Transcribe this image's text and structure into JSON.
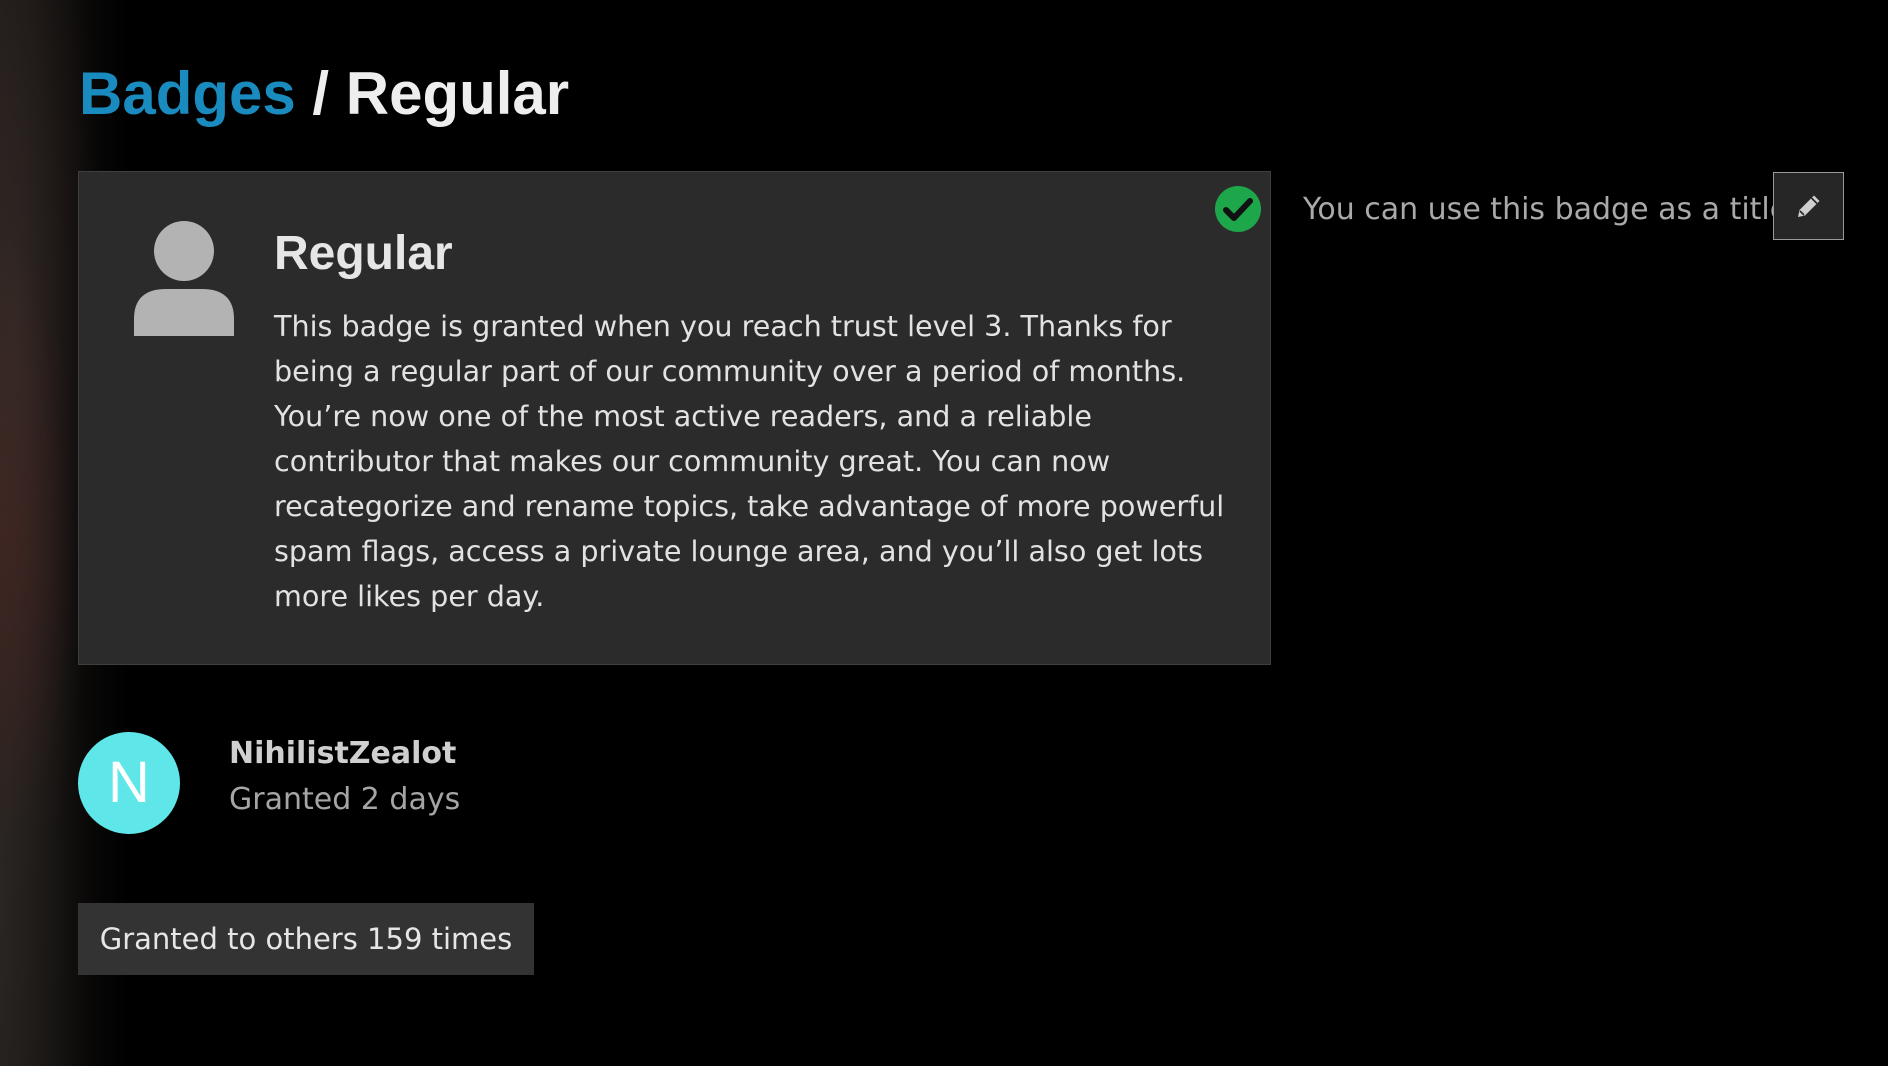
{
  "breadcrumb": {
    "parent_label": "Badges",
    "separator": " / ",
    "current_label": "Regular"
  },
  "badge": {
    "title": "Regular",
    "description": "This badge is granted when you reach trust level 3. Thanks for being a regular part of our community over a period of months. You’re now one of the most active readers, and a reliable contributor that makes our community great. You can now recategorize and rename topics, take advantage of more powerful spam flags, access a private lounge area, and you’ll also get lots more likes per day.",
    "icon": "user-icon",
    "granted_status_icon": "check-circle-icon"
  },
  "title_option": {
    "hint": "You can use this badge as a title",
    "edit_icon": "pencil-icon"
  },
  "grant": {
    "avatar_letter": "N",
    "username": "NihilistZealot",
    "granted_text": "Granted 2 days"
  },
  "others": {
    "button_label": "Granted to others 159 times"
  },
  "colors": {
    "link": "#1a8bbf",
    "avatar_bg": "#5ee6e8",
    "check_green": "#1ea64b",
    "card_bg": "#2b2b2b"
  }
}
